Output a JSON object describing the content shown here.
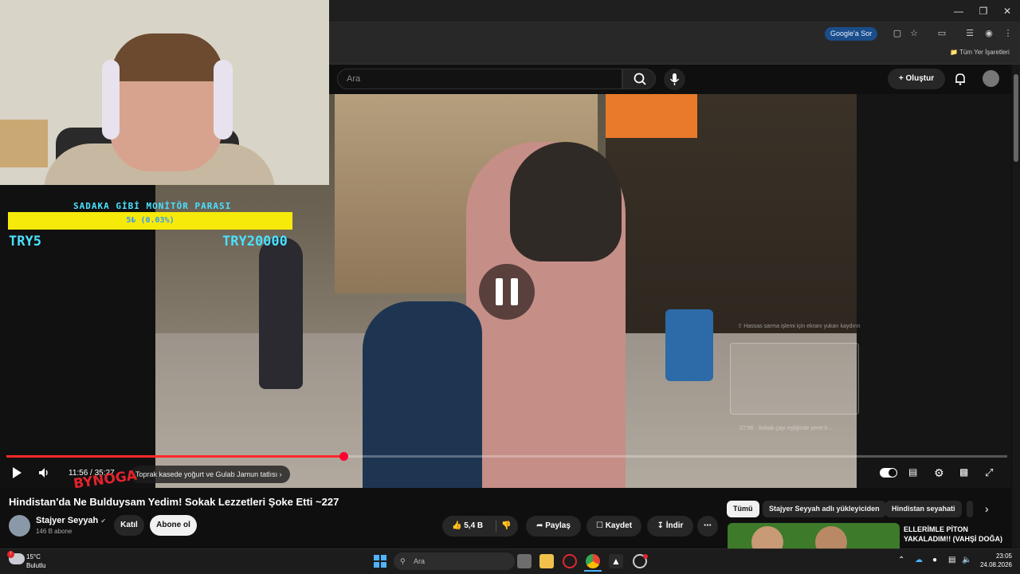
{
  "browser": {
    "google_chip": "Google'a Sor",
    "bookmarks_label": "Tüm Yer İşaretleri"
  },
  "youtube": {
    "search_placeholder": "Ara",
    "create_label": "Oluştur"
  },
  "overlay": {
    "donation_title": "SADAKA GİBİ MONİTÖR PARASI",
    "donation_progress": "5₺ (0.03%)",
    "donation_progress_fraction": 0.0003,
    "donation_min": "TRY5",
    "donation_max": "TRY20000",
    "sticker_text": "BYNOGA"
  },
  "player": {
    "time_current": "11:56",
    "time_total": "35:27",
    "time_display": "11:56 / 35:27",
    "chapter_label": "Toprak kasede yoğurt ve Gulab Jamun tatlısı",
    "progress_fraction": 0.337,
    "hint_text": "Hassas sarma işlemi için ekranı yukarı kaydırın",
    "hint_caption": "27:56 · Sokak çayı eşliğinde yerel h..."
  },
  "video": {
    "title": "Hindistan'da Ne Bulduysam Yedim! Sokak Lezzetleri Şoke Etti ~227",
    "channel": "Stajyer Seyyah",
    "subscribers": "146 B abone",
    "join_label": "Katıl",
    "subscribe_label": "Abone ol",
    "likes": "5,4 B",
    "share_label": "Paylaş",
    "save_label": "Kaydet",
    "download_label": "İndir"
  },
  "sidebar": {
    "chips": [
      "Tümü",
      "Stajyer Seyyah adlı yükleyiciden",
      "Hindistan seyahati"
    ],
    "suggested_title": "ELLERİMLE PİTON YAKALADIM!! (VAHŞİ DOĞA)"
  },
  "taskbar": {
    "temperature": "15°C",
    "weather": "Bulutlu",
    "search_label": "Ara",
    "time": "23:05",
    "date": "24.08.2026"
  },
  "colors": {
    "accent_red": "#ff0033",
    "donation_yellow": "#f6ea0a",
    "donation_cyan": "#4be0ff",
    "youtube_dark": "#0f0f0f"
  }
}
